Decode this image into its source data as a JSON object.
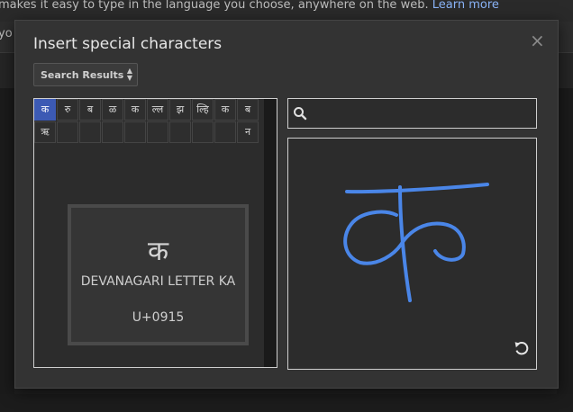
{
  "background": {
    "line1": "makes it easy to type in the language you choose, anywhere on the web.",
    "learn_more": "Learn more",
    "line2": "yo"
  },
  "dialog": {
    "title": "Insert special characters",
    "close": "×",
    "select": {
      "value": "Search Results"
    },
    "grid": {
      "row1": [
        "क",
        "रु",
        "ब",
        "ळ",
        "क",
        "ल्ल",
        "झ",
        "ल्हि",
        "क",
        "ब"
      ],
      "row2": [
        "ऋ",
        "",
        "",
        "",
        "",
        "",
        "",
        "",
        "",
        "न"
      ]
    },
    "preview": {
      "glyph": "क",
      "name": "DEVANAGARI LETTER KA",
      "code": "U+0915"
    },
    "search": {
      "placeholder": "",
      "value": ""
    },
    "draw": {
      "ink_color": "#4a86e8"
    }
  }
}
